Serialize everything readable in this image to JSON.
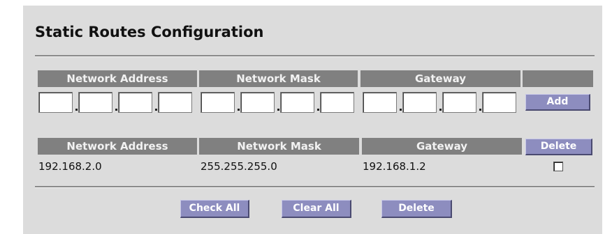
{
  "page": {
    "title": "Static Routes Configuration"
  },
  "entry": {
    "headers": [
      "Network Address",
      "Network Mask",
      "Gateway"
    ],
    "add_label": "Add",
    "network_address": [
      "",
      "",
      "",
      ""
    ],
    "network_mask": [
      "",
      "",
      "",
      ""
    ],
    "gateway": [
      "",
      "",
      "",
      ""
    ]
  },
  "routes": {
    "headers": [
      "Network Address",
      "Network Mask",
      "Gateway"
    ],
    "delete_header_label": "Delete",
    "rows": [
      {
        "network_address": "192.168.2.0",
        "network_mask": "255.255.255.0",
        "gateway": "192.168.1.2",
        "selected": false
      }
    ]
  },
  "actions": {
    "check_all": "Check All",
    "clear_all": "Clear All",
    "delete": "Delete"
  },
  "colors": {
    "panel_bg": "#dcdcdc",
    "header_bg": "#808080",
    "button_bg": "#8d8dbf"
  }
}
